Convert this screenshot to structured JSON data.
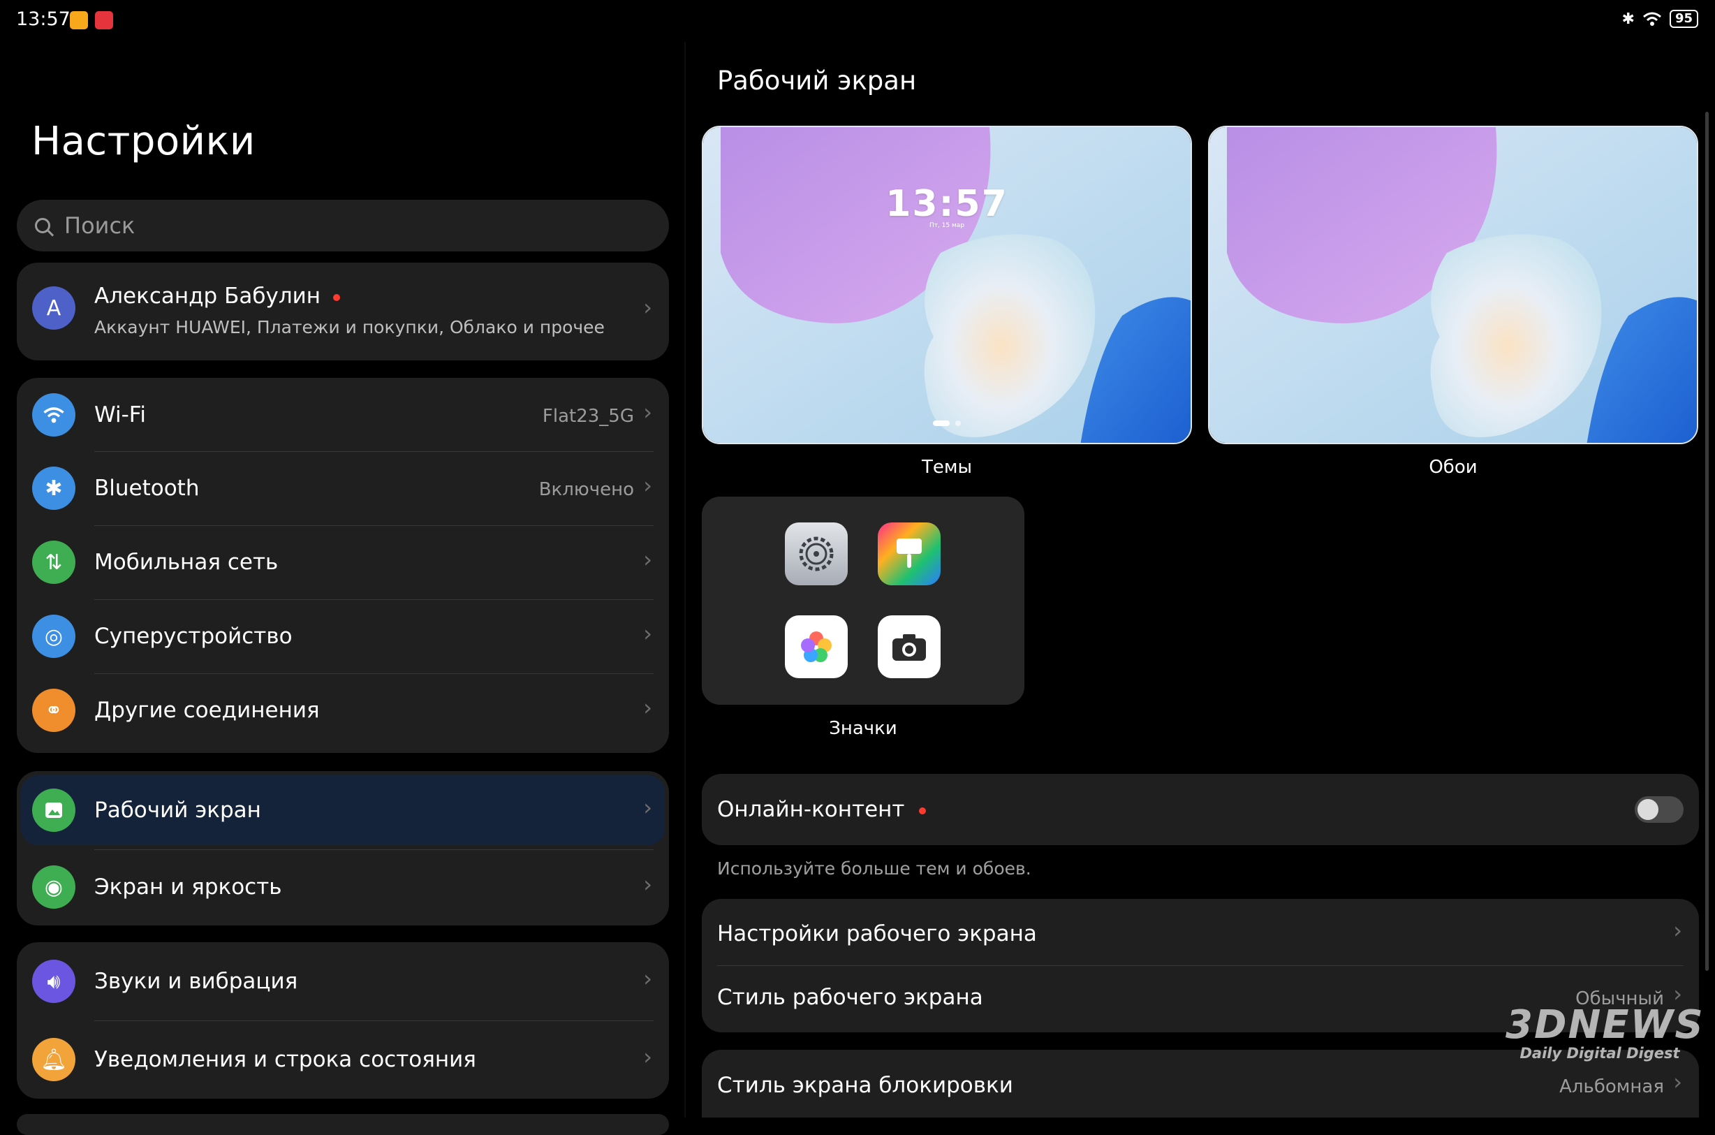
{
  "status_bar": {
    "time": "13:57",
    "battery": "95"
  },
  "settings": {
    "title": "Настройки",
    "search_placeholder": "Поиск",
    "account": {
      "avatar_letter": "А",
      "name": "Александр Бабулин",
      "subtitle": "Аккаунт HUAWEI, Платежи и покупки, Облако и прочее"
    },
    "connections": [
      {
        "label": "Wi-Fi",
        "value": "Flat23_5G",
        "icon": "wifi-icon",
        "color": "#3d8fe3"
      },
      {
        "label": "Bluetooth",
        "value": "Включено",
        "icon": "bluetooth-icon",
        "color": "#3d8fe3"
      },
      {
        "label": "Мобильная сеть",
        "value": "",
        "icon": "mobile-network-icon",
        "color": "#3fae52"
      },
      {
        "label": "Суперустройство",
        "value": "",
        "icon": "superdevice-icon",
        "color": "#3d8fe3"
      },
      {
        "label": "Другие соединения",
        "value": "",
        "icon": "link-icon",
        "color": "#f08d2c"
      }
    ],
    "display": [
      {
        "label": "Рабочий экран",
        "icon": "home-screen-icon",
        "color": "#3fae52",
        "selected": true
      },
      {
        "label": "Экран и яркость",
        "icon": "eye-icon",
        "color": "#3fae52"
      }
    ],
    "sound": [
      {
        "label": "Звуки и вибрация",
        "icon": "volume-icon",
        "color": "#6a56e0"
      },
      {
        "label": "Уведомления и строка состояния",
        "icon": "bell-icon",
        "color": "#f2a33a"
      }
    ]
  },
  "home_screen": {
    "title": "Рабочий экран",
    "preview_time": "13:57",
    "preview_date": "Пт, 15 мар",
    "themes_label": "Темы",
    "wallpapers_label": "Обои",
    "icons_label": "Значки",
    "online_content": {
      "label": "Онлайн-контент",
      "enabled": false,
      "hint": "Используйте больше тем и обоев."
    },
    "settings_label": "Настройки рабочего экрана",
    "style_label": "Стиль рабочего экрана",
    "style_value": "Обычный",
    "lock_style_label": "Стиль экрана блокировки",
    "lock_style_value": "Альбомная"
  },
  "watermark": {
    "main": "3DNEWS",
    "sub": "Daily Digital Digest"
  }
}
